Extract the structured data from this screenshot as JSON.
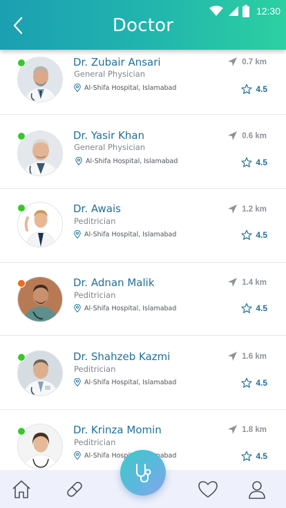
{
  "status_bar": {
    "time": "12:30"
  },
  "header": {
    "title": "Doctor"
  },
  "doctors": [
    {
      "name": "Dr. Zubair Ansari",
      "specialty": "General Physician",
      "hospital": "Al-Shifa Hospital, Islamabad",
      "distance": "0.7 km",
      "rating": "4.5",
      "status": "online",
      "status_color": "#38c72b"
    },
    {
      "name": "Dr. Yasir Khan",
      "specialty": "General Physician",
      "hospital": "Al-Shifa Hospital, Islamabad",
      "distance": "0.6 km",
      "rating": "4.5",
      "status": "online",
      "status_color": "#38c72b"
    },
    {
      "name": "Dr. Awais",
      "specialty": "Peditrician",
      "hospital": "Al-Shifa Hospital, Islamabad",
      "distance": "1.2 km",
      "rating": "4.5",
      "status": "online",
      "status_color": "#38c72b"
    },
    {
      "name": "Dr. Adnan Malik",
      "specialty": "Peditrician",
      "hospital": "Al-Shifa Hospital, Islamabad",
      "distance": "1.4 km",
      "rating": "4.5",
      "status": "busy",
      "status_color": "#f06a1d"
    },
    {
      "name": "Dr. Shahzeb Kazmi",
      "specialty": "Peditrician",
      "hospital": "Al-Shifa Hospital, Islamabad",
      "distance": "1.6 km",
      "rating": "4.5",
      "status": "online",
      "status_color": "#38c72b"
    },
    {
      "name": "Dr. Krinza Momin",
      "specialty": "Peditrician",
      "hospital": "Al-Shifa Hospital, Islamabad",
      "distance": "1.8 km",
      "rating": "4.5",
      "status": "online",
      "status_color": "#38c72b"
    }
  ],
  "bottom_nav": {
    "items": [
      {
        "icon": "home-icon"
      },
      {
        "icon": "pill-icon"
      },
      {
        "icon": "stethoscope-icon"
      },
      {
        "icon": "heart-icon"
      },
      {
        "icon": "profile-icon"
      }
    ]
  },
  "colors": {
    "header_gradient_start": "#1b9fb2",
    "header_gradient_end": "#2cd0a2",
    "name_text": "#1f6f9c",
    "online": "#38c72b",
    "busy": "#f06a1d"
  }
}
